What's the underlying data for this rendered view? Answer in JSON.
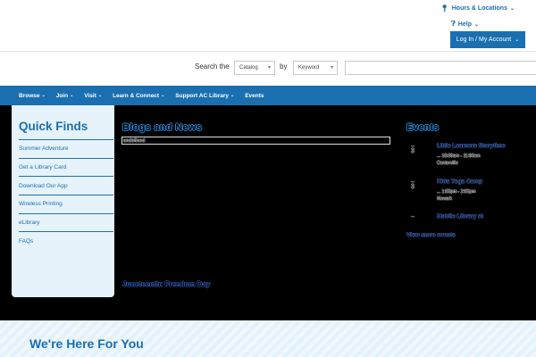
{
  "header": {
    "hours_label": "Hours & Locations",
    "help_label": "Help",
    "login_label": "Log In / My Account"
  },
  "search": {
    "label": "Search the",
    "catalog_value": "Catalog",
    "by_label": "by",
    "field_value": "Keyword",
    "placeholder": ""
  },
  "nav": {
    "items": [
      {
        "label": "Browse",
        "dropdown": true
      },
      {
        "label": "Join",
        "dropdown": true
      },
      {
        "label": "Visit",
        "dropdown": true
      },
      {
        "label": "Learn & Connect",
        "dropdown": true
      },
      {
        "label": "Support AC Library",
        "dropdown": true
      },
      {
        "label": "Events",
        "dropdown": false
      }
    ]
  },
  "quick_finds": {
    "title": "Quick Finds",
    "items": [
      "Summer Adventure",
      "Get a Library Card",
      "Download Our App",
      "Wireless Printing",
      "eLibrary",
      "FAQs"
    ]
  },
  "blogs": {
    "title": "Blogs and News",
    "box_text": "undefined",
    "link_text": "Juneteenth: Freedom Day"
  },
  "events": {
    "title": "Events",
    "items": [
      {
        "date_line": "...",
        "day": "3",
        "title": "Little Learners Storytime",
        "meta1": "... 10:30am - 11:00am",
        "meta2": "Centerville"
      },
      {
        "date_line": "...",
        "day": "3",
        "title": "Kids Yoga Camp",
        "meta1": "... 1:00pm - 2:00pm",
        "meta2": "Newark"
      },
      {
        "date_line": "...",
        "day": "",
        "title": "Mobile Library at",
        "meta1": "",
        "meta2": ""
      }
    ],
    "view_more": "View more events"
  },
  "bottom": {
    "title": "We're Here For You"
  },
  "colors": {
    "brand_blue": "#1a6fb0",
    "panel_blue": "#e6f3fb",
    "dark_band": "#000000"
  }
}
